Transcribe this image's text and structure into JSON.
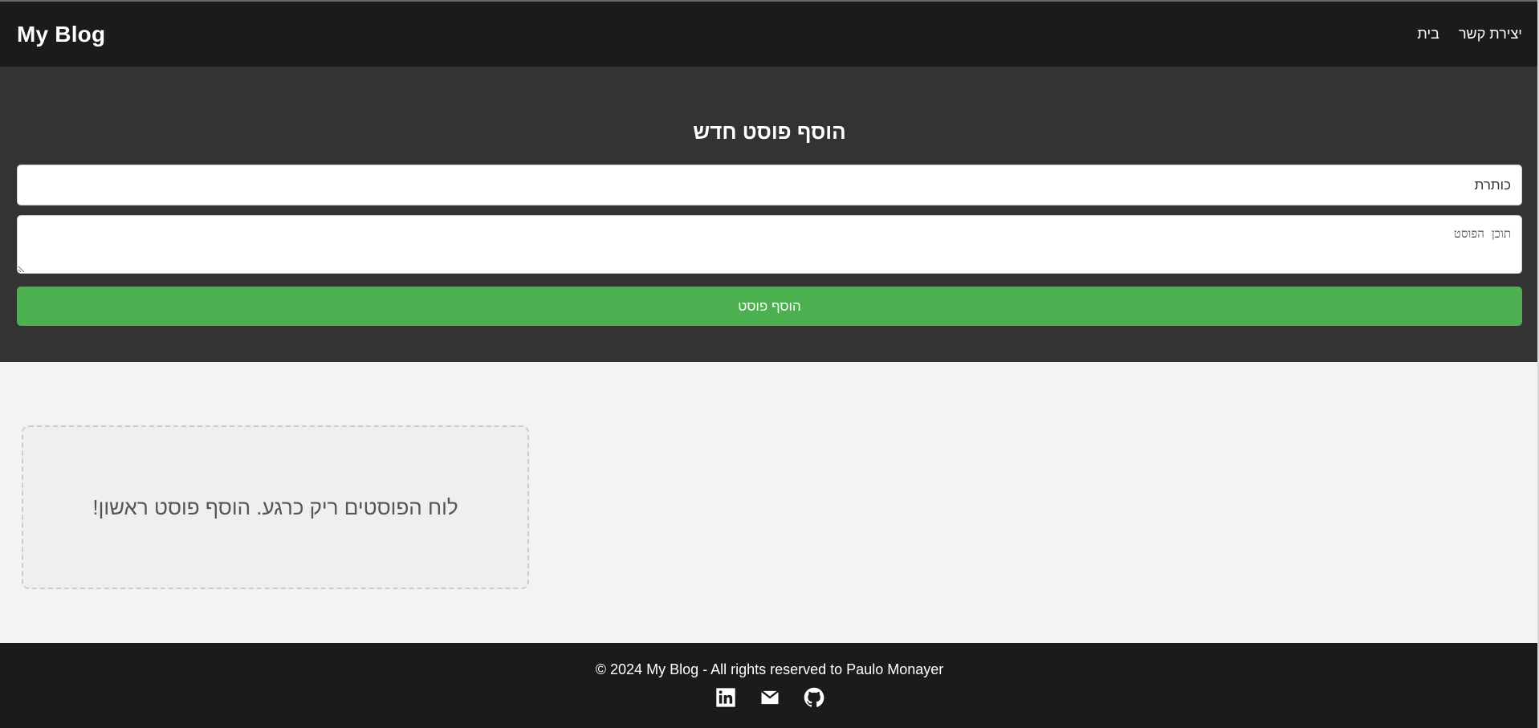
{
  "header": {
    "brand": "My Blog",
    "nav": [
      {
        "label": "בית",
        "icon": ""
      },
      {
        "label": "יצירת קשר",
        "icon": ""
      }
    ]
  },
  "composer": {
    "heading": "הוסף פוסט חדש",
    "title_placeholder": "כותרת",
    "content_placeholder": "תוכן הפוסט",
    "submit_label": "הוסף פוסט"
  },
  "board": {
    "empty_message": "לוח הפוסטים ריק כרגע. הוסף פוסט ראשון!"
  },
  "footer": {
    "copyright": "© 2024 My Blog - All rights reserved to Paulo Monayer",
    "socials": [
      {
        "icon": "linkedin-icon"
      },
      {
        "icon": "mail-icon"
      },
      {
        "icon": "github-icon"
      }
    ]
  },
  "colors": {
    "header_bg": "#1b1b1b",
    "composer_bg": "#333333",
    "accent": "#4caf50",
    "board_bg": "#f3f3f3"
  }
}
